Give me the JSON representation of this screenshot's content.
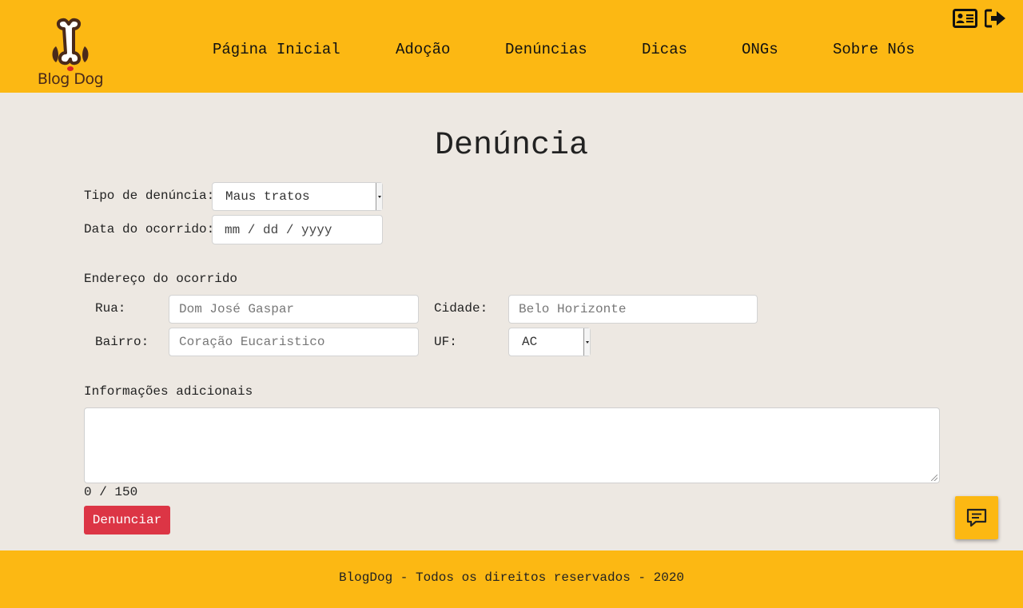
{
  "brand": {
    "name": "Blog Dog",
    "logo_icon": "dog-bone-icon"
  },
  "nav": {
    "items": [
      {
        "label": "Página Inicial"
      },
      {
        "label": "Adoção"
      },
      {
        "label": "Denúncias"
      },
      {
        "label": "Dicas"
      },
      {
        "label": "ONGs"
      },
      {
        "label": "Sobre Nós"
      }
    ]
  },
  "header_icons": {
    "profile": "id-card-icon",
    "logout": "sign-out-icon"
  },
  "page": {
    "title": "Denúncia"
  },
  "form": {
    "type_label": "Tipo de denúncia:",
    "type_value": "Maus tratos",
    "date_label": "Data do ocorrido:",
    "date_placeholder": "mm / dd / yyyy",
    "address_heading": "Endereço do ocorrido",
    "street_label": "Rua:",
    "street_placeholder": "Dom José Gaspar",
    "city_label": "Cidade:",
    "city_placeholder": "Belo Horizonte",
    "district_label": "Bairro:",
    "district_placeholder": "Coração Eucaristico",
    "state_label": "UF:",
    "state_value": "AC",
    "additional_label": "Informações adicionais",
    "additional_value": "",
    "counter": "0 / 150",
    "submit_label": "Denunciar"
  },
  "chat": {
    "icon": "chat-icon"
  },
  "footer": {
    "text": "BlogDog - Todos os direitos reservados - 2020"
  },
  "colors": {
    "header_bg": "#fcb813",
    "page_bg": "#ede8e2",
    "submit_bg": "#dc3545"
  }
}
